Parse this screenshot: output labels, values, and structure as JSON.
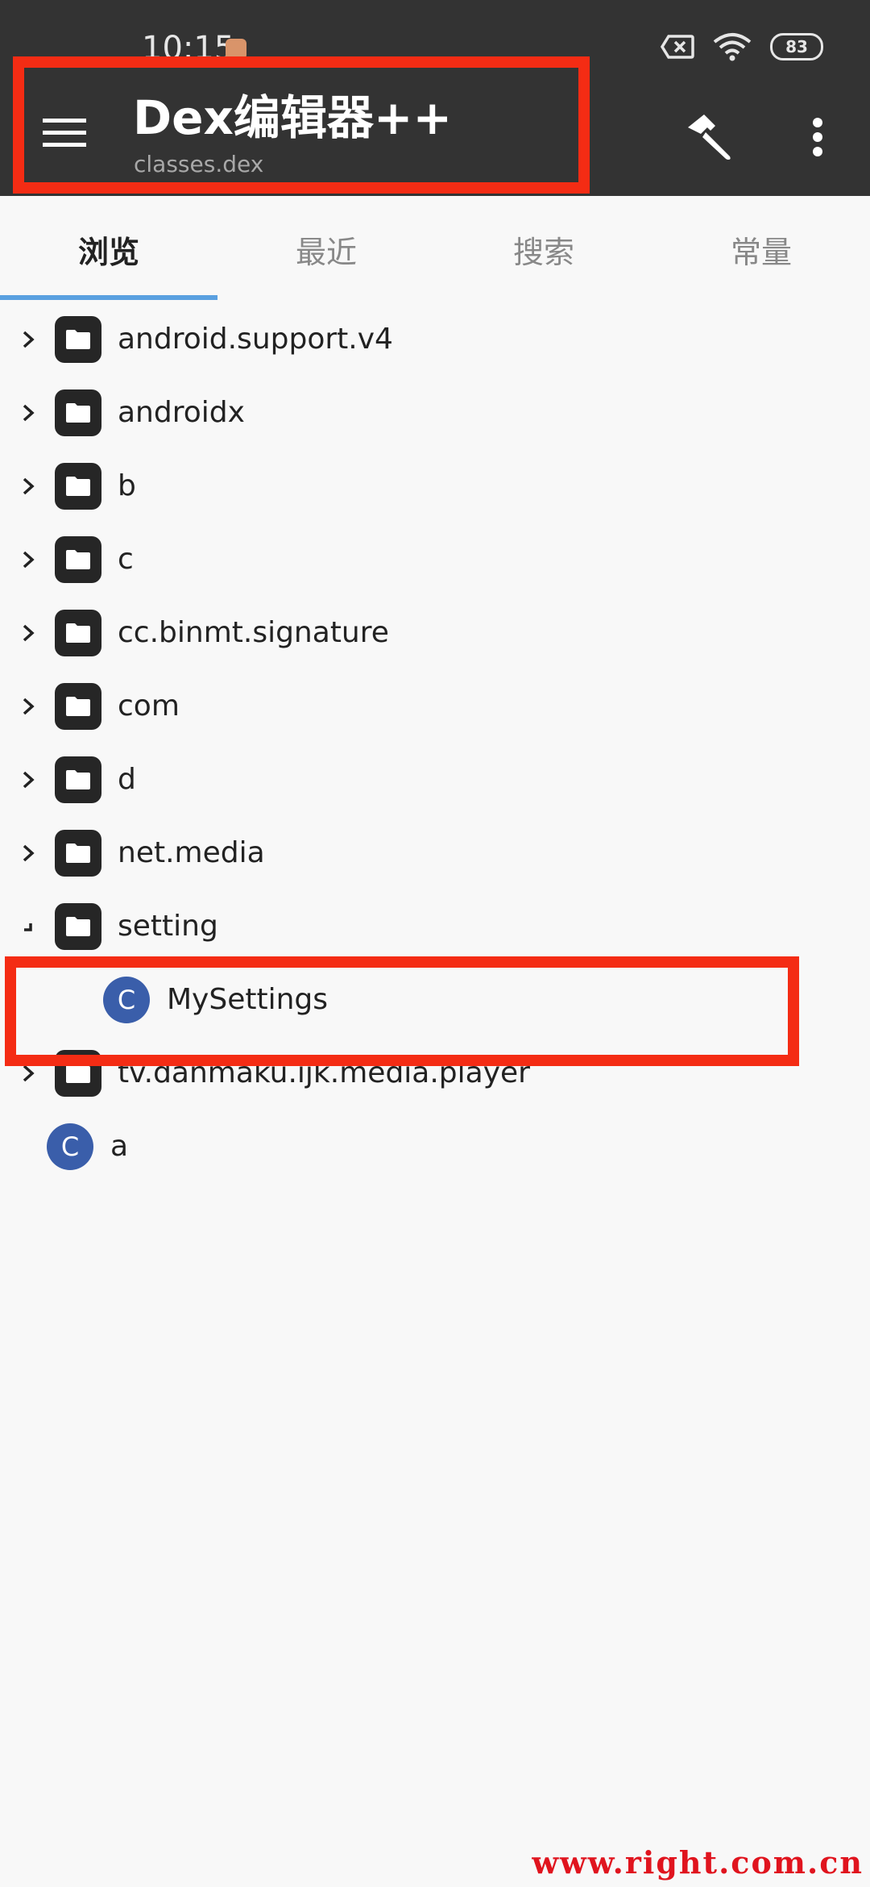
{
  "status_bar": {
    "time": "10:15",
    "battery": "83"
  },
  "app_bar": {
    "title": "Dex编辑器++",
    "subtitle": "classes.dex"
  },
  "tabs": [
    {
      "label": "浏览",
      "active": true
    },
    {
      "label": "最近",
      "active": false
    },
    {
      "label": "搜索",
      "active": false
    },
    {
      "label": "常量",
      "active": false
    }
  ],
  "tree": {
    "packages": [
      "android.support.v4",
      "androidx",
      "b",
      "c",
      "cc.binmt.signature",
      "com",
      "d",
      "net.media",
      "setting"
    ],
    "expanded_child": {
      "badge": "C",
      "label": "MySettings"
    },
    "after": [
      {
        "kind": "package",
        "label": "tv.danmaku.ijk.media.player"
      },
      {
        "kind": "class",
        "badge": "C",
        "label": "a"
      }
    ]
  },
  "watermark": "www.right.com.cn",
  "colors": {
    "app_bar": "#333333",
    "highlight": "#f42c14",
    "tab_indicator": "#5aa0e0",
    "class_badge": "#3a5eaa"
  }
}
